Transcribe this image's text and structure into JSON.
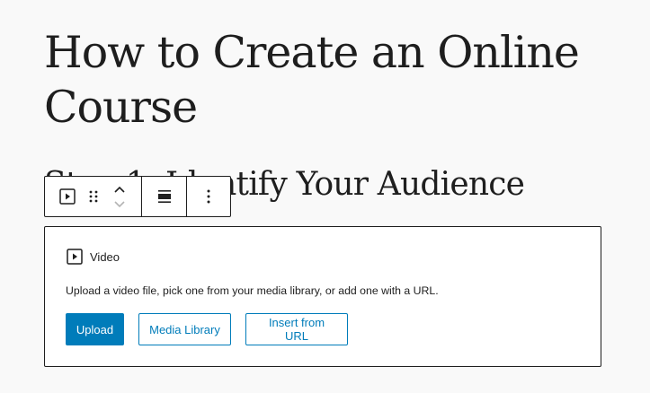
{
  "post": {
    "title": "How to Create an Online Course"
  },
  "heading": {
    "text": "Step 1: Identify Your Audience"
  },
  "toolbar": {
    "block_type_icon": "video-icon",
    "drag_icon": "drag-handle-icon",
    "move_up_icon": "chevron-up-icon",
    "move_down_icon": "chevron-down-icon",
    "align_icon": "align-center-icon",
    "more_icon": "more-vertical-icon"
  },
  "video_block": {
    "label": "Video",
    "label_icon": "video-icon",
    "instructions": "Upload a video file, pick one from your media library, or add one with a URL.",
    "upload_label": "Upload",
    "media_library_label": "Media Library",
    "insert_url_label": "Insert from URL"
  },
  "colors": {
    "accent": "#007cba",
    "text": "#1e1e1e",
    "background": "#f9f9f9"
  }
}
